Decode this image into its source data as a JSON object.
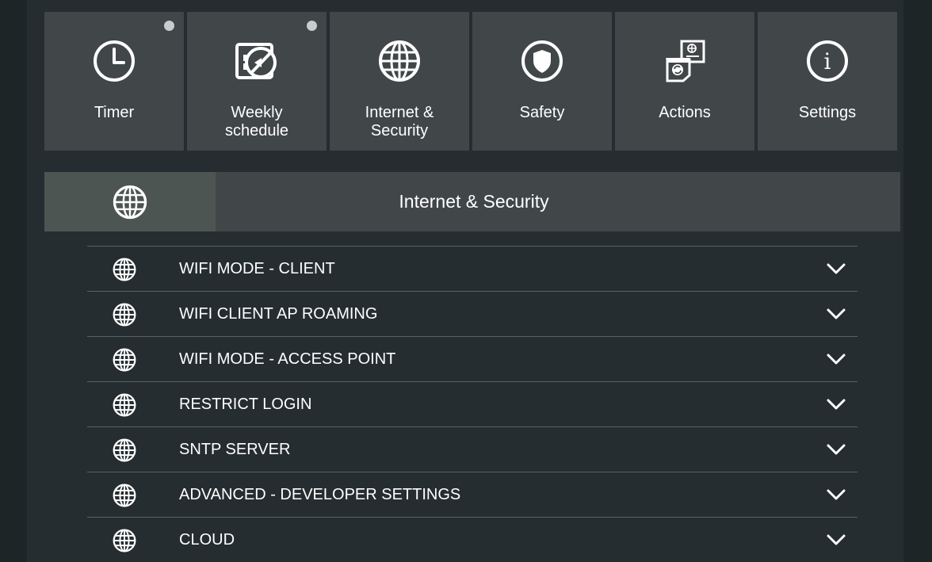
{
  "tiles": [
    {
      "label": "Timer",
      "icon": "clock-icon",
      "dot": true
    },
    {
      "label": "Weekly\nschedule",
      "icon": "calendar-disabled-icon",
      "dot": true
    },
    {
      "label": "Internet &\nSecurity",
      "icon": "globe-icon",
      "dot": false
    },
    {
      "label": "Safety",
      "icon": "shield-icon",
      "dot": false
    },
    {
      "label": "Actions",
      "icon": "actions-icon",
      "dot": false
    },
    {
      "label": "Settings",
      "icon": "info-icon",
      "dot": false
    }
  ],
  "section": {
    "title": "Internet & Security",
    "icon": "globe-icon"
  },
  "rows": [
    {
      "label": "WIFI MODE - CLIENT",
      "icon": "globe-icon"
    },
    {
      "label": "WIFI CLIENT AP ROAMING",
      "icon": "globe-icon"
    },
    {
      "label": "WIFI MODE - ACCESS POINT",
      "icon": "globe-icon"
    },
    {
      "label": "RESTRICT LOGIN",
      "icon": "globe-icon"
    },
    {
      "label": "SNTP SERVER",
      "icon": "globe-icon"
    },
    {
      "label": "ADVANCED - DEVELOPER SETTINGS",
      "icon": "globe-icon"
    },
    {
      "label": "CLOUD",
      "icon": "globe-icon"
    }
  ],
  "colors": {
    "background": "#252d30",
    "tile": "#414648",
    "header_icon_bg": "#4d5553",
    "text": "#ffffff",
    "divider": "#5b6163"
  }
}
